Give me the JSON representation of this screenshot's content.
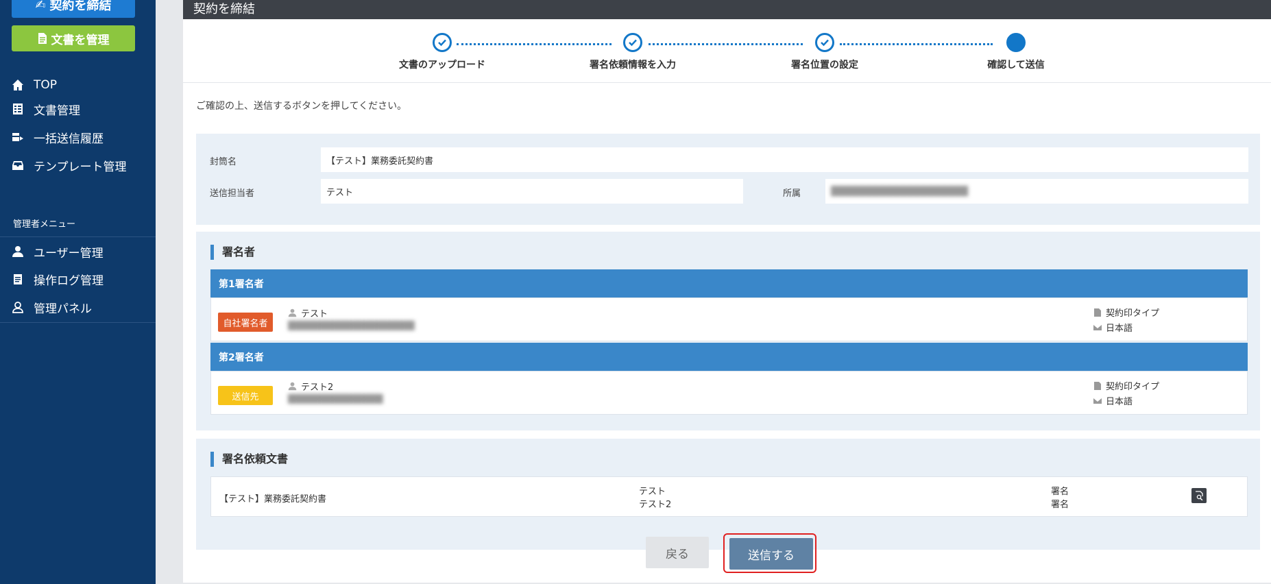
{
  "sidebar": {
    "contract_button": "契約を締結",
    "documents_button": "文書を管理",
    "nav": [
      {
        "label": "TOP",
        "icon": "home-icon"
      },
      {
        "label": "文書管理",
        "icon": "table-icon"
      },
      {
        "label": "一括送信履歴",
        "icon": "bulk-send-icon"
      },
      {
        "label": "テンプレート管理",
        "icon": "template-icon"
      }
    ],
    "admin_title": "管理者メニュー",
    "admin_nav": [
      {
        "label": "ユーザー管理",
        "icon": "user-icon"
      },
      {
        "label": "操作ログ管理",
        "icon": "clipboard-icon"
      },
      {
        "label": "管理パネル",
        "icon": "admin-panel-icon"
      }
    ]
  },
  "header": {
    "title": "契約を締結"
  },
  "steps": [
    {
      "label": "文書のアップロード",
      "state": "done"
    },
    {
      "label": "署名依頼情報を入力",
      "state": "done"
    },
    {
      "label": "署名位置の設定",
      "state": "done"
    },
    {
      "label": "確認して送信",
      "state": "current"
    }
  ],
  "instruction": "ご確認の上、送信するボタンを押してください。",
  "envelope": {
    "name_label": "封筒名",
    "name_value": "【テスト】業務委託契約書",
    "sender_label": "送信担当者",
    "sender_value": "テスト",
    "dept_label": "所属",
    "dept_value": "████████████████████"
  },
  "signers": {
    "title": "署名者",
    "items": [
      {
        "header": "第1署名者",
        "badge": "自社署名者",
        "badge_color": "#e15b2b",
        "name": "テスト",
        "email": "████████████████████",
        "stamp_type": "契約印タイプ",
        "language": "日本語"
      },
      {
        "header": "第2署名者",
        "badge": "送信先",
        "badge_color": "#f7c319",
        "name": "テスト2",
        "email": "███████████████",
        "stamp_type": "契約印タイプ",
        "language": "日本語"
      }
    ]
  },
  "documents": {
    "title": "署名依頼文書",
    "rows": [
      {
        "name": "【テスト】業務委託契約書",
        "signers": [
          "テスト",
          "テスト2"
        ],
        "actions": [
          "署名",
          "署名"
        ]
      }
    ]
  },
  "buttons": {
    "back": "戻る",
    "send": "送信する"
  },
  "colors": {
    "sidebar": "#0e3a6b",
    "accent": "#1277c8",
    "section_header": "#3a87c9"
  }
}
